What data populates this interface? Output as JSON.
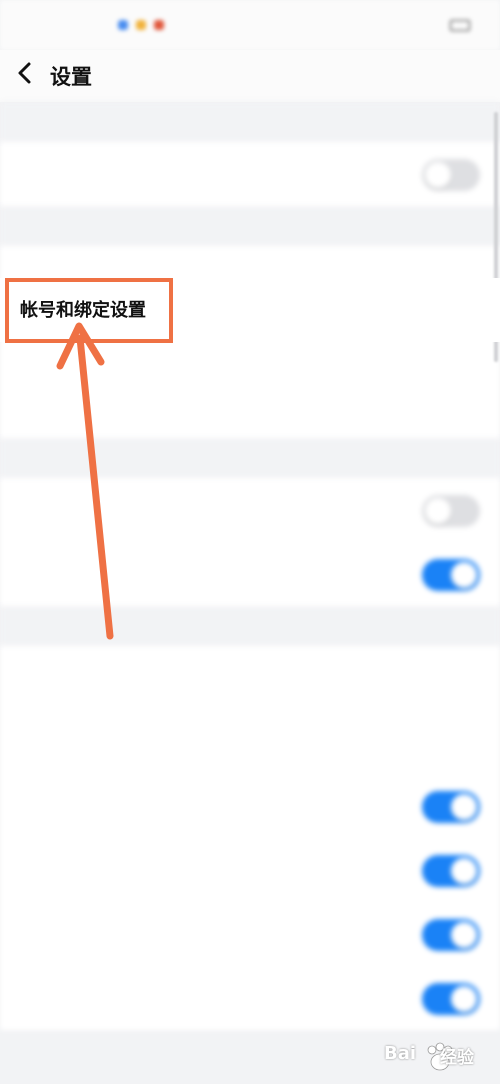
{
  "statusbar": {
    "time": "",
    "right": ""
  },
  "header": {
    "title": "设置"
  },
  "sections": [
    {
      "header": "",
      "rows": [
        {
          "label": "",
          "toggle": "off"
        }
      ]
    },
    {
      "header": "",
      "rows": [
        {
          "label": "帐号和绑定设置",
          "highlighted": true
        },
        {
          "label": ""
        },
        {
          "label": "",
          "value": ""
        }
      ]
    },
    {
      "header": "",
      "rows": [
        {
          "label": "",
          "toggle": "off"
        },
        {
          "label": "",
          "toggle": "on"
        }
      ]
    },
    {
      "header": "",
      "rows": [
        {
          "label": ""
        },
        {
          "label": "",
          "sub": ""
        },
        {
          "label": "",
          "toggle": "on"
        },
        {
          "label": "",
          "toggle": "on"
        },
        {
          "label": "",
          "toggle": "on"
        },
        {
          "label": "",
          "toggle": "on"
        }
      ]
    }
  ],
  "annotation": {
    "color": "#ef7144"
  },
  "watermark": {
    "text": "Bai",
    "text2": "经验"
  },
  "colors": {
    "accent": "#1a82f6",
    "toggle_off": "#dedfe2",
    "background": "#f2f3f5"
  }
}
